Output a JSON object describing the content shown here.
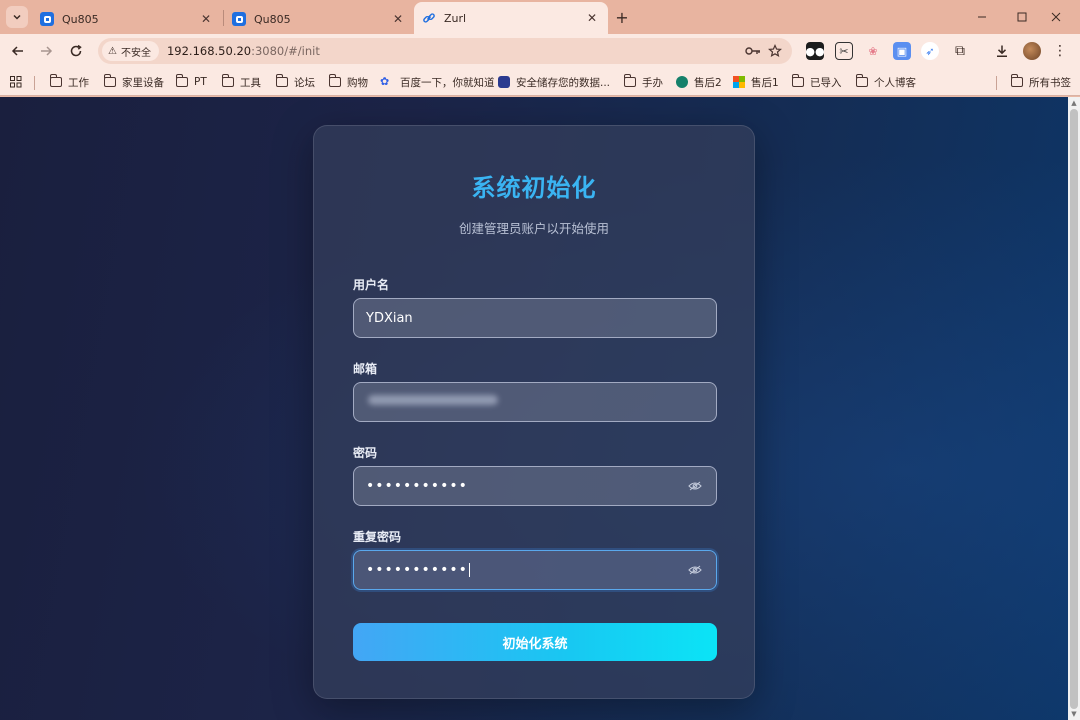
{
  "browser": {
    "tabs": [
      {
        "title": "Qu805"
      },
      {
        "title": "Qu805"
      },
      {
        "title": "Zurl"
      }
    ],
    "address": {
      "security_label": "不安全",
      "url_host": "192.168.50.20",
      "url_rest": ":3080/#/init"
    },
    "bookmarks": [
      {
        "label": "工作",
        "icon": "folder-icon"
      },
      {
        "label": "家里设备",
        "icon": "folder-icon"
      },
      {
        "label": "PT",
        "icon": "folder-icon"
      },
      {
        "label": "工具",
        "icon": "folder-icon"
      },
      {
        "label": "论坛",
        "icon": "folder-icon"
      },
      {
        "label": "购物",
        "icon": "folder-icon"
      },
      {
        "label": "百度一下，你就知道",
        "icon": "baidu-icon"
      },
      {
        "label": "安全储存您的数据...",
        "icon": "site-icon"
      },
      {
        "label": "手办",
        "icon": "folder-icon"
      },
      {
        "label": "售后2",
        "icon": "site-icon"
      },
      {
        "label": "售后1",
        "icon": "windows-icon"
      },
      {
        "label": "已导入",
        "icon": "folder-icon"
      },
      {
        "label": "个人博客",
        "icon": "folder-icon"
      },
      {
        "label": "所有书签",
        "icon": "folder-icon"
      }
    ]
  },
  "form": {
    "title": "系统初始化",
    "subtitle": "创建管理员账户以开始使用",
    "username_label": "用户名",
    "username_value": "YDXian",
    "email_label": "邮箱",
    "password_label": "密码",
    "password_mask": "•••••••••••",
    "confirm_label": "重复密码",
    "confirm_mask": "•••••••••••",
    "submit_label": "初始化系统"
  },
  "colors": {
    "title": "#3ab4f2",
    "button_start": "#43a6f5",
    "button_end": "#0be4f6",
    "page_bg": "#1a1f3e"
  }
}
